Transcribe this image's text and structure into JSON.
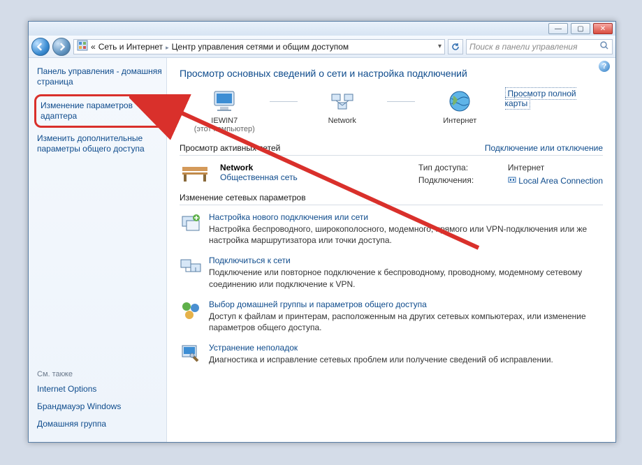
{
  "titlebar": {},
  "nav": {
    "crumb_prefix": "«",
    "crumb1": "Сеть и Интернет",
    "crumb2": "Центр управления сетями и общим доступом",
    "search_placeholder": "Поиск в панели управления"
  },
  "sidebar": {
    "home": "Панель управления - домашняя страница",
    "adapter": "Изменение параметров адаптера",
    "sharing": "Изменить дополнительные параметры общего доступа",
    "seealso": "См. также",
    "links": {
      "inetopt": "Internet Options",
      "firewall": "Брандмауэр Windows",
      "homegroup": "Домашняя группа"
    }
  },
  "main": {
    "heading": "Просмотр основных сведений о сети и настройка подключений",
    "map": {
      "pc_name": "IEWIN7",
      "pc_sub": "(этот компьютер)",
      "network_name": "Network",
      "internet_name": "Интернет",
      "fullmap": "Просмотр полной карты"
    },
    "active": {
      "title": "Просмотр активных сетей",
      "toggle": "Подключение или отключение",
      "name": "Network",
      "type": "Общественная сеть",
      "access_label": "Тип доступа:",
      "access_value": "Интернет",
      "conn_label": "Подключения:",
      "conn_value": "Local Area Connection"
    },
    "change": {
      "title": "Изменение сетевых параметров",
      "items": [
        {
          "link": "Настройка нового подключения или сети",
          "desc": "Настройка беспроводного, широкополосного, модемного, прямого или VPN-подключения или же настройка маршрутизатора или точки доступа."
        },
        {
          "link": "Подключиться к сети",
          "desc": "Подключение или повторное подключение к беспроводному, проводному, модемному сетевому соединению или подключение к VPN."
        },
        {
          "link": "Выбор домашней группы и параметров общего доступа",
          "desc": "Доступ к файлам и принтерам, расположенным на других сетевых компьютерах, или изменение параметров общего доступа."
        },
        {
          "link": "Устранение неполадок",
          "desc": "Диагностика и исправление сетевых проблем или получение сведений об исправлении."
        }
      ]
    }
  }
}
